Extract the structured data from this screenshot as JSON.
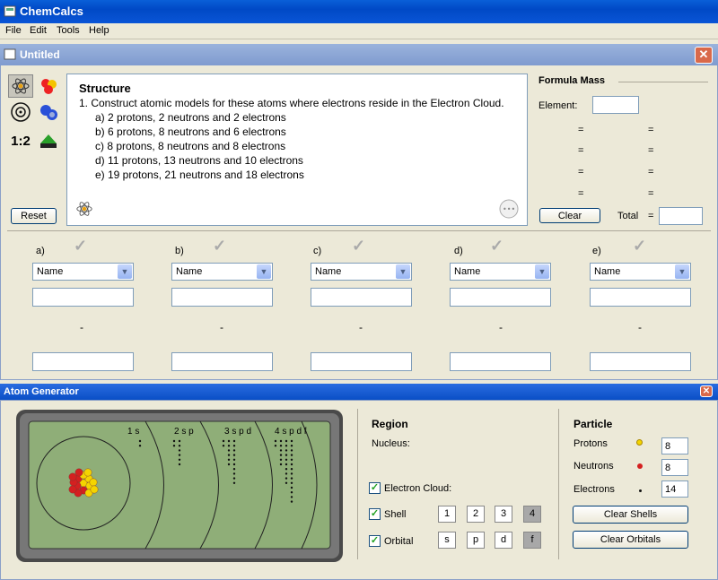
{
  "app": {
    "title": "ChemCalcs"
  },
  "menu": [
    "File",
    "Edit",
    "Tools",
    "Help"
  ],
  "document": {
    "title": "Untitled"
  },
  "toolbar": {
    "reset_label": "Reset",
    "ratio_label": "1:2"
  },
  "structure": {
    "title": "Structure",
    "instruction": "1. Construct atomic models for these atoms where electrons reside in the Electron Cloud.",
    "items": [
      "a) 2 protons, 2 neutrons and 2 electrons",
      "b) 6 protons, 8 neutrons and 6 electrons",
      "c) 8 protons, 8 neutrons and 8 electrons",
      "d) 11 protons, 13 neutrons and 10 electrons",
      "e) 19 protons, 21 neutrons and 18 electrons"
    ]
  },
  "formula_mass": {
    "title": "Formula Mass",
    "element_label": "Element:",
    "clear_label": "Clear",
    "total_label": "Total",
    "eq": "="
  },
  "answers": {
    "columns": [
      {
        "label": "a)",
        "select": "Name",
        "dash": "-"
      },
      {
        "label": "b)",
        "select": "Name",
        "dash": "-"
      },
      {
        "label": "c)",
        "select": "Name",
        "dash": "-"
      },
      {
        "label": "d)",
        "select": "Name",
        "dash": "-"
      },
      {
        "label": "e)",
        "select": "Name",
        "dash": "-"
      }
    ]
  },
  "generator": {
    "title": "Atom Generator",
    "shell_labels": [
      "1 s",
      "2 s p",
      "3 s p d",
      "4 s p d f"
    ],
    "region": {
      "title": "Region",
      "nucleus_label": "Nucleus:",
      "electron_cloud_label": "Electron Cloud:",
      "shell_label": "Shell",
      "orbital_label": "Orbital",
      "shell_buttons": [
        "1",
        "2",
        "3",
        "4"
      ],
      "orbital_buttons": [
        "s",
        "p",
        "d",
        "f"
      ],
      "active_shell": "4",
      "active_orbital": "f"
    },
    "particle": {
      "title": "Particle",
      "protons_label": "Protons",
      "neutrons_label": "Neutrons",
      "electrons_label": "Electrons",
      "protons": "8",
      "neutrons": "8",
      "electrons": "14",
      "clear_shells_label": "Clear Shells",
      "clear_orbitals_label": "Clear Orbitals"
    }
  },
  "colors": {
    "title_blue": "#0049c6",
    "canvas_green": "#8fae78",
    "proton": "#f4d400",
    "neutron": "#d42020"
  }
}
